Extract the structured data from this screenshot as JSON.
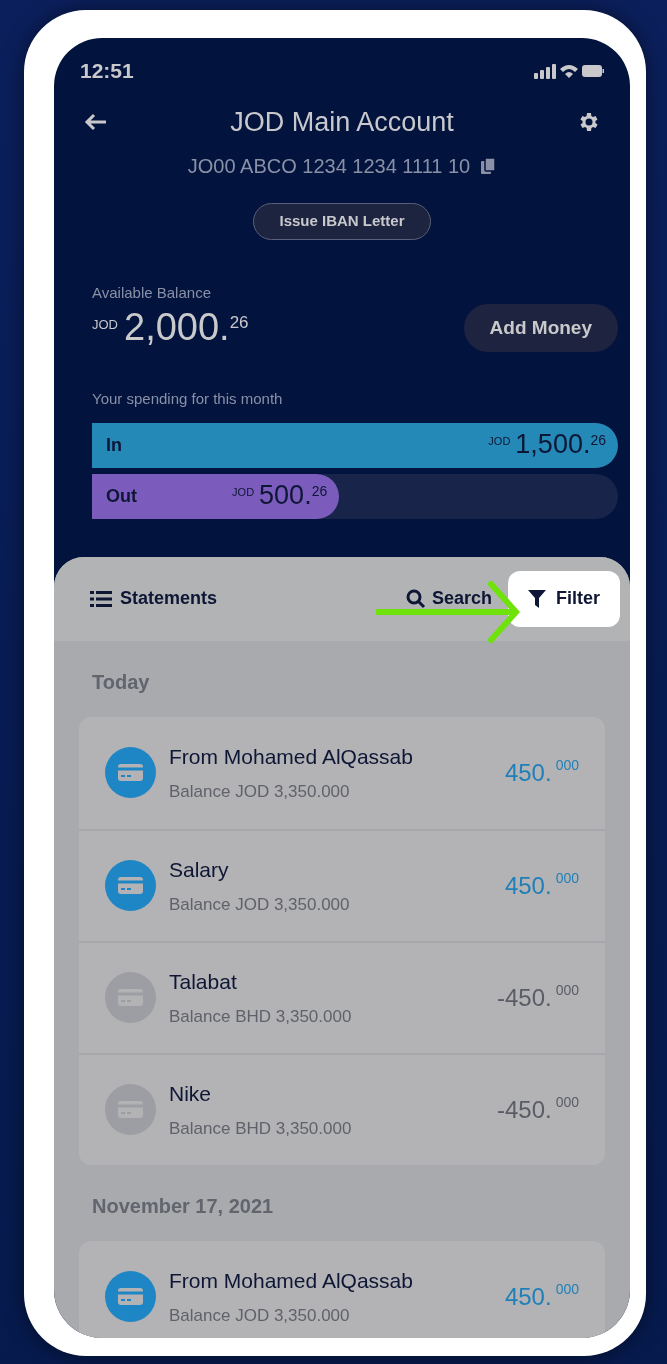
{
  "status_bar": {
    "time": "12:51"
  },
  "header": {
    "title": "JOD Main Account",
    "iban": "JO00 ABCO 1234 1234 1111 10",
    "iban_button": "Issue IBAN Letter"
  },
  "balance": {
    "label": "Available Balance",
    "currency": "JOD",
    "whole": "2,000.",
    "fraction": "26",
    "add_button": "Add Money"
  },
  "spending": {
    "label": "Your spending for this month",
    "bars": [
      {
        "kind": "in",
        "label": "In",
        "currency": "JOD",
        "whole": "1,500.",
        "fraction": "26",
        "level": 1.0
      },
      {
        "kind": "out",
        "label": "Out",
        "currency": "JOD",
        "whole": "500.",
        "fraction": "26",
        "level": 0.47
      }
    ]
  },
  "toolbar": {
    "statements": "Statements",
    "search": "Search",
    "filter": "Filter",
    "filter_highlighted": true
  },
  "groups": [
    {
      "date": "Today",
      "rows": [
        {
          "kind": "credit",
          "title": "From Mohamed AlQassab",
          "balance": "Balance JOD 3,350.000",
          "whole": "450.",
          "fraction": "000"
        },
        {
          "kind": "credit",
          "title": "Salary",
          "balance": "Balance JOD 3,350.000",
          "whole": "450.",
          "fraction": "000"
        },
        {
          "kind": "debit",
          "title": "Talabat",
          "balance": "Balance BHD 3,350.000",
          "whole": "-450.",
          "fraction": "000"
        },
        {
          "kind": "debit",
          "title": "Nike",
          "balance": "Balance BHD 3,350.000",
          "whole": "-450.",
          "fraction": "000"
        }
      ]
    },
    {
      "date": "November 17, 2021",
      "rows": [
        {
          "kind": "credit",
          "title": "From Mohamed AlQassab",
          "balance": "Balance JOD 3,350.000",
          "whole": "450.",
          "fraction": "000"
        }
      ]
    }
  ]
}
